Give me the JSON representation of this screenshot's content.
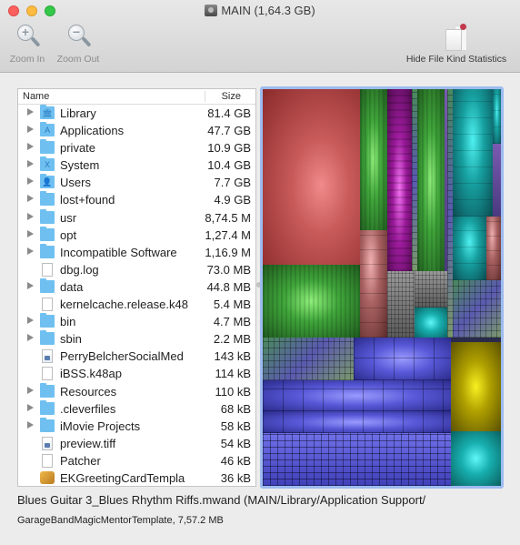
{
  "window": {
    "title": "MAIN (1,64.3 GB)",
    "title_icon": "hard-disk-icon"
  },
  "toolbar": {
    "zoom_in_label": "Zoom In",
    "zoom_out_label": "Zoom Out",
    "hide_stats_label": "Hide File Kind Statistics"
  },
  "list": {
    "columns": {
      "name": "Name",
      "size": "Size"
    },
    "rows": [
      {
        "name": "Library",
        "size": "81.4 GB",
        "type": "folder",
        "expandable": true,
        "icon": "library-folder-icon",
        "glyph": "🏛"
      },
      {
        "name": "Applications",
        "size": "47.7 GB",
        "type": "folder",
        "expandable": true,
        "icon": "applications-folder-icon",
        "glyph": "A"
      },
      {
        "name": "private",
        "size": "10.9 GB",
        "type": "folder",
        "expandable": true,
        "icon": "folder-icon",
        "glyph": ""
      },
      {
        "name": "System",
        "size": "10.4 GB",
        "type": "folder",
        "expandable": true,
        "icon": "system-folder-icon",
        "glyph": "X"
      },
      {
        "name": "Users",
        "size": "7.7 GB",
        "type": "folder",
        "expandable": true,
        "icon": "users-folder-icon",
        "glyph": "👤"
      },
      {
        "name": "lost+found",
        "size": "4.9 GB",
        "type": "folder",
        "expandable": true,
        "icon": "folder-icon",
        "glyph": ""
      },
      {
        "name": "usr",
        "size": "8,74.5 M",
        "type": "folder",
        "expandable": true,
        "icon": "folder-icon",
        "glyph": ""
      },
      {
        "name": "opt",
        "size": "1,27.4 M",
        "type": "folder",
        "expandable": true,
        "icon": "folder-icon",
        "glyph": ""
      },
      {
        "name": "Incompatible Software",
        "size": "1,16.9 M",
        "type": "folder",
        "expandable": true,
        "icon": "folder-icon",
        "glyph": ""
      },
      {
        "name": "dbg.log",
        "size": "73.0 MB",
        "type": "file",
        "expandable": false,
        "icon": "document-icon",
        "glyph": ""
      },
      {
        "name": "data",
        "size": "44.8 MB",
        "type": "folder",
        "expandable": true,
        "icon": "folder-icon",
        "glyph": ""
      },
      {
        "name": "kernelcache.release.k48",
        "size": "5.4 MB",
        "type": "file",
        "expandable": false,
        "icon": "document-icon",
        "glyph": ""
      },
      {
        "name": "bin",
        "size": "4.7 MB",
        "type": "folder",
        "expandable": true,
        "icon": "folder-icon",
        "glyph": ""
      },
      {
        "name": "sbin",
        "size": "2.2 MB",
        "type": "folder",
        "expandable": true,
        "icon": "folder-icon",
        "glyph": ""
      },
      {
        "name": "PerryBelcherSocialMed",
        "size": "143 kB",
        "type": "image",
        "expandable": false,
        "icon": "image-file-icon",
        "glyph": ""
      },
      {
        "name": "iBSS.k48ap",
        "size": "114 kB",
        "type": "file",
        "expandable": false,
        "icon": "document-icon",
        "glyph": ""
      },
      {
        "name": "Resources",
        "size": "110 kB",
        "type": "folder",
        "expandable": true,
        "icon": "folder-icon",
        "glyph": ""
      },
      {
        "name": ".cleverfiles",
        "size": "68 kB",
        "type": "folder",
        "expandable": true,
        "icon": "folder-icon",
        "glyph": ""
      },
      {
        "name": "iMovie Projects",
        "size": "58 kB",
        "type": "folder",
        "expandable": true,
        "icon": "folder-icon",
        "glyph": ""
      },
      {
        "name": "preview.tiff",
        "size": "54 kB",
        "type": "image",
        "expandable": false,
        "icon": "image-file-icon",
        "glyph": ""
      },
      {
        "name": "Patcher",
        "size": "46 kB",
        "type": "file",
        "expandable": false,
        "icon": "document-icon",
        "glyph": ""
      },
      {
        "name": "EKGreetingCardTempla",
        "size": "36 kB",
        "type": "package",
        "expandable": false,
        "icon": "package-icon",
        "glyph": ""
      }
    ]
  },
  "treemap": {
    "colors": {
      "red": "#c85a5a",
      "green": "#3fa63a",
      "purple": "#9a1a9a",
      "teal": "#17a0a0",
      "blue": "#5858d8",
      "yellow": "#b0a000",
      "cyan": "#18b0b0",
      "selection_border": "#9dbbf0"
    }
  },
  "status": {
    "line1": "Blues Guitar 3_Blues Rhythm Riffs.mwand (MAIN/Library/Application Support/",
    "line2": "GarageBandMagicMentorTemplate, 7,57.2 MB"
  }
}
